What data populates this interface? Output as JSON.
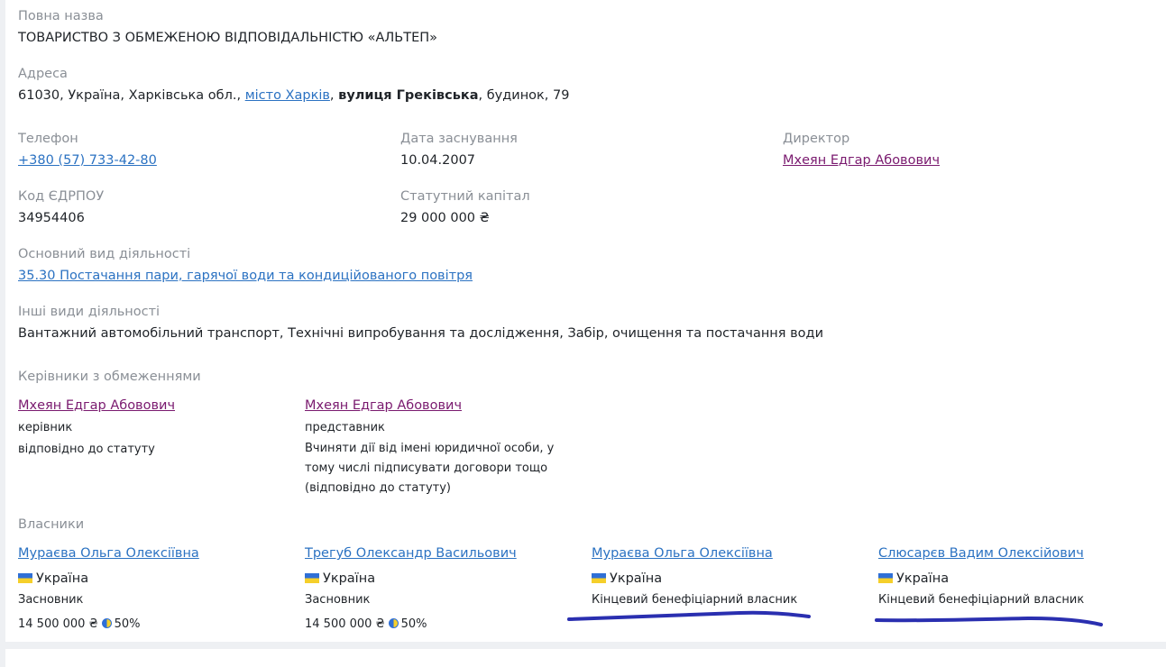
{
  "company": {
    "full_name_label": "Повна назва",
    "full_name": "ТОВАРИСТВО З ОБМЕЖЕНОЮ ВІДПОВІДАЛЬНІСТЮ «АЛЬТЕП»",
    "address_label": "Адреса",
    "address_prefix": "61030, Україна, Харківська обл.,",
    "address_city": "місто Харків",
    "address_comma": ",",
    "address_street": "вулиця Греківська",
    "address_suffix": ", будинок, 79",
    "phone_label": "Телефон",
    "phone": "+380 (57) 733-42-80",
    "founded_label": "Дата заснування",
    "founded": "10.04.2007",
    "director_label": "Директор",
    "director": "Мхеян Едгар Абовович",
    "edrpou_label": "Код ЄДРПОУ",
    "edrpou": "34954406",
    "capital_label": "Статутний капітал",
    "capital": "29 000 000 ₴",
    "main_activity_label": "Основний вид діяльності",
    "main_activity": "35.30 Постачання пари, гарячої води та кондиційованого повітря",
    "other_activities_label": "Інші види діяльності",
    "other_activities": "Вантажний автомобільний транспорт, Технічні випробування та дослідження, Забір, очищення та постачання води"
  },
  "managers": {
    "label": "Керівники з обмеженнями",
    "items": [
      {
        "name": "Мхеян Едгар Абовович",
        "role": "керівник",
        "note": "відповідно до статуту"
      },
      {
        "name": "Мхеян Едгар Абовович",
        "role": "представник",
        "note": "Вчиняти дії від імені юридичної особи, у тому числі підписувати договори тощо (відповідно до статуту)"
      }
    ]
  },
  "owners": {
    "label": "Власники",
    "items": [
      {
        "name": "Мураєва Ольга Олексіївна",
        "country": "Україна",
        "role": "Засновник",
        "amount": "14 500 000 ₴",
        "percent": "50%"
      },
      {
        "name": "Трегуб Олександр Васильович",
        "country": "Україна",
        "role": "Засновник",
        "amount": "14 500 000 ₴",
        "percent": "50%"
      },
      {
        "name": "Мураєва Ольга Олексіївна",
        "country": "Україна",
        "role": "Кінцевий бенефіціарний власник"
      },
      {
        "name": "Слюсарєв Вадим Олексійович",
        "country": "Україна",
        "role": "Кінцевий бенефіціарний власник"
      }
    ]
  },
  "colors": {
    "link": "#2b72c2",
    "visited_link": "#7a1a6f",
    "label": "#8a8f96",
    "annotation_ink": "#2a2fb0",
    "flag_blue": "#2f6fd6",
    "flag_yellow": "#f5cf2a"
  }
}
